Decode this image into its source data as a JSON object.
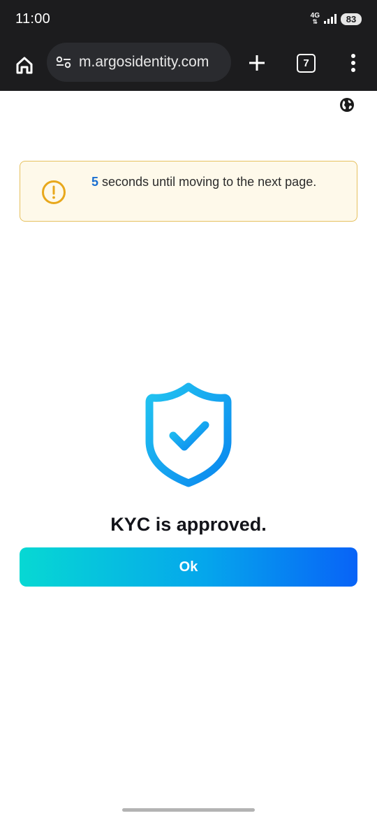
{
  "status": {
    "time": "11:00",
    "network": "4G",
    "battery": "83"
  },
  "browser": {
    "url": "m.argosidentity.com",
    "tab_count": "7",
    "icons": [
      "home-icon",
      "site-settings-icon",
      "new-tab-plus-icon",
      "tab-switcher-icon",
      "more-menu-icon"
    ]
  },
  "page": {
    "notice": {
      "countdown": "5",
      "text": " seconds until moving to the next page."
    },
    "message": "KYC is approved.",
    "ok_button": "Ok"
  },
  "colors": {
    "notice_bg": "#fef9ea",
    "notice_border": "#e6c15f",
    "warning_icon": "#e8a81c",
    "countdown": "#1a6fd1",
    "shield_gradient": [
      "#22c4f0",
      "#0a86ef"
    ],
    "button_gradient": [
      "#07d8d3",
      "#0863f7"
    ]
  }
}
